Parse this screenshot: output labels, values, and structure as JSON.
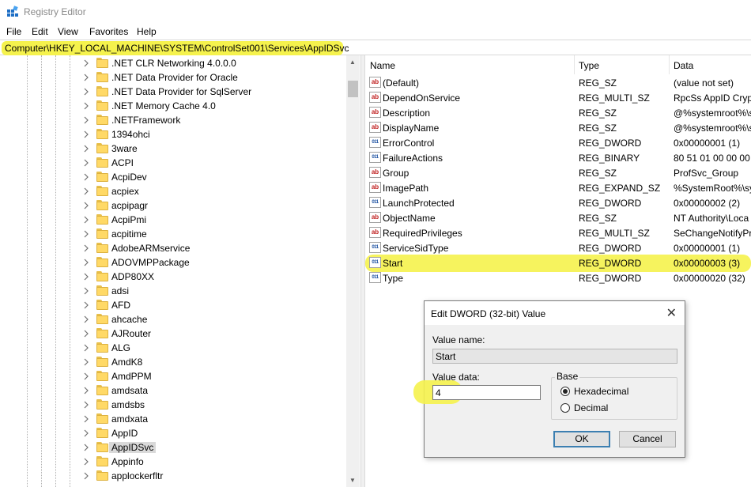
{
  "window": {
    "title": "Registry Editor"
  },
  "menu": [
    "File",
    "Edit",
    "View",
    "Favorites",
    "Help"
  ],
  "address": "Computer\\HKEY_LOCAL_MACHINE\\SYSTEM\\ControlSet001\\Services\\AppIDSvc",
  "tree": {
    "items": [
      ".NET CLR Networking 4.0.0.0",
      ".NET Data Provider for Oracle",
      ".NET Data Provider for SqlServer",
      ".NET Memory Cache 4.0",
      ".NETFramework",
      "1394ohci",
      "3ware",
      "ACPI",
      "AcpiDev",
      "acpiex",
      "acpipagr",
      "AcpiPmi",
      "acpitime",
      "AdobeARMservice",
      "ADOVMPPackage",
      "ADP80XX",
      "adsi",
      "AFD",
      "ahcache",
      "AJRouter",
      "ALG",
      "AmdK8",
      "AmdPPM",
      "amdsata",
      "amdsbs",
      "amdxata",
      "AppID",
      "AppIDSvc",
      "Appinfo",
      "applockerfltr"
    ],
    "selected": "AppIDSvc"
  },
  "columns": {
    "name": "Name",
    "type": "Type",
    "data": "Data"
  },
  "values": [
    {
      "name": "(Default)",
      "type": "REG_SZ",
      "data": "(value not set)",
      "kind": "sz"
    },
    {
      "name": "DependOnService",
      "type": "REG_MULTI_SZ",
      "data": "RpcSs AppID Crypt",
      "kind": "sz"
    },
    {
      "name": "Description",
      "type": "REG_SZ",
      "data": "@%systemroot%\\s",
      "kind": "sz"
    },
    {
      "name": "DisplayName",
      "type": "REG_SZ",
      "data": "@%systemroot%\\s",
      "kind": "sz"
    },
    {
      "name": "ErrorControl",
      "type": "REG_DWORD",
      "data": "0x00000001 (1)",
      "kind": "bin"
    },
    {
      "name": "FailureActions",
      "type": "REG_BINARY",
      "data": "80 51 01 00 00 00 00",
      "kind": "bin"
    },
    {
      "name": "Group",
      "type": "REG_SZ",
      "data": "ProfSvc_Group",
      "kind": "sz"
    },
    {
      "name": "ImagePath",
      "type": "REG_EXPAND_SZ",
      "data": "%SystemRoot%\\sy",
      "kind": "sz"
    },
    {
      "name": "LaunchProtected",
      "type": "REG_DWORD",
      "data": "0x00000002 (2)",
      "kind": "bin"
    },
    {
      "name": "ObjectName",
      "type": "REG_SZ",
      "data": "NT Authority\\Loca",
      "kind": "sz"
    },
    {
      "name": "RequiredPrivileges",
      "type": "REG_MULTI_SZ",
      "data": "SeChangeNotifyPr",
      "kind": "sz"
    },
    {
      "name": "ServiceSidType",
      "type": "REG_DWORD",
      "data": "0x00000001 (1)",
      "kind": "bin"
    },
    {
      "name": "Start",
      "type": "REG_DWORD",
      "data": "0x00000003 (3)",
      "kind": "bin"
    },
    {
      "name": "Type",
      "type": "REG_DWORD",
      "data": "0x00000020 (32)",
      "kind": "bin"
    }
  ],
  "icons": {
    "sz": "ab",
    "bin": "011"
  },
  "dialog": {
    "title": "Edit DWORD (32-bit) Value",
    "value_name_label": "Value name:",
    "value_name": "Start",
    "value_data_label": "Value data:",
    "value_data": "4",
    "base_label": "Base",
    "base_options": [
      "Hexadecimal",
      "Decimal"
    ],
    "base_selected": "Hexadecimal",
    "ok": "OK",
    "cancel": "Cancel",
    "close_glyph": "✕"
  },
  "colors": {
    "highlight": "#f5f24d",
    "selection": "#d9d9d9",
    "default_button_border": "#3c7fb1"
  }
}
